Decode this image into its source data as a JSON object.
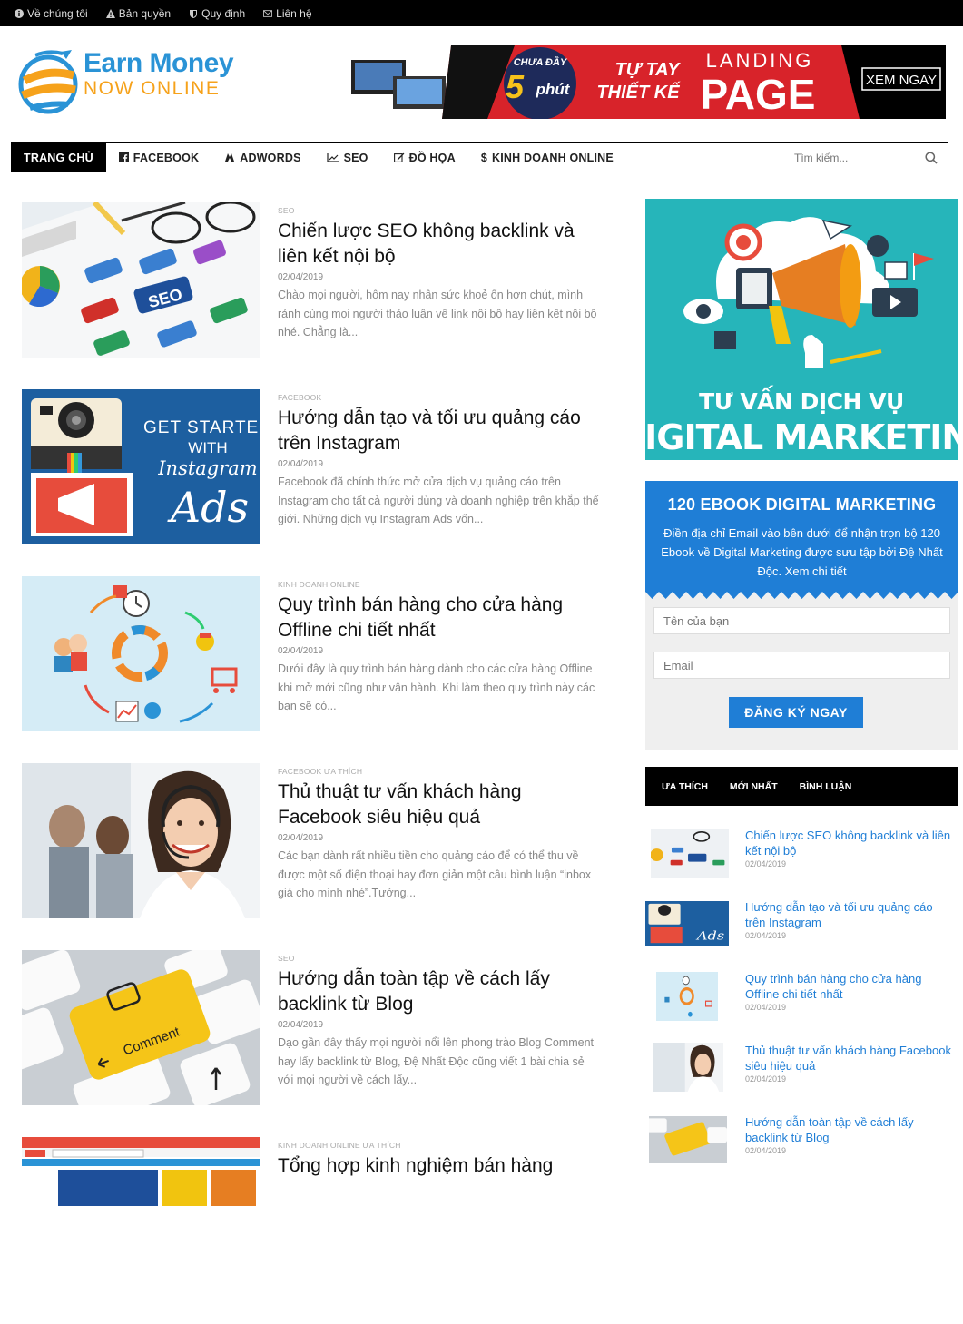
{
  "topbar": {
    "links": [
      {
        "label": "Về chúng tôi",
        "icon": "info-icon"
      },
      {
        "label": "Bản quyền",
        "icon": "warning-icon"
      },
      {
        "label": "Quy định",
        "icon": "shield-icon"
      },
      {
        "label": "Liên hệ",
        "icon": "mail-icon"
      }
    ]
  },
  "logo": {
    "word1": "Earn ",
    "word2": "Money",
    "line2": "NOW ONLINE"
  },
  "banner": {
    "line1": "CHƯA ĐẦY",
    "big": "5",
    "unit": "phút",
    "mid1": "TỰ TAY",
    "mid2": "THIẾT KẾ",
    "top": "LANDING",
    "main": "PAGE",
    "cta": "XEM NGAY"
  },
  "nav": {
    "items": [
      {
        "label": "TRANG CHỦ"
      },
      {
        "label": "FACEBOOK"
      },
      {
        "label": "ADWORDS"
      },
      {
        "label": "SEO"
      },
      {
        "label": "ĐỒ HỌA"
      },
      {
        "label": "KINH DOANH ONLINE"
      }
    ],
    "search_placeholder": "Tìm kiếm..."
  },
  "posts": [
    {
      "category": "SEO",
      "title": "Chiến lược SEO không backlink và liên kết nội bộ",
      "date": "02/04/2019",
      "excerpt": "Chào mọi người, hôm nay nhân sức khoẻ ổn hơn chút, mình rảnh cùng mọi người thảo luận về link nội bộ hay liên kết nội bộ nhé. Chẳng là..."
    },
    {
      "category": "FACEBOOK",
      "title": "Hướng dẫn tạo và tối ưu quảng cáo trên Instagram",
      "date": "02/04/2019",
      "excerpt": "Facebook đã chính thức mở cửa dịch vụ quảng cáo trên Instagram cho tất cả người dùng và doanh nghiệp trên khắp thế giới. Những dịch vụ Instagram Ads vốn..."
    },
    {
      "category": "KINH DOANH ONLINE",
      "title": "Quy trình bán hàng cho cửa hàng Offline chi tiết nhất",
      "date": "02/04/2019",
      "excerpt": "Dưới đây là quy trình bán hàng dành cho các cửa hàng Offline khi mở mới cũng như vận hành. Khi làm theo quy trình này các bạn sẽ có..."
    },
    {
      "category": "FACEBOOK ƯA THÍCH",
      "title": "Thủ thuật tư vấn khách hàng Facebook siêu hiệu quả",
      "date": "02/04/2019",
      "excerpt": "Các bạn dành rất nhiều tiền cho quảng cáo để có thể thu về được một số điện thoại hay đơn giản một câu bình luận “inbox giá cho mình nhé”.Tưởng..."
    },
    {
      "category": "SEO",
      "title": "Hướng dẫn toàn tập về cách lấy backlink từ Blog",
      "date": "02/04/2019",
      "excerpt": "Dạo gần đây thấy mọi người nổi lên phong trào Blog Comment hay lấy backlink từ Blog, Đệ Nhất Độc cũng viết 1 bài chia sẻ với mọi người về cách lấy..."
    },
    {
      "category": "KINH DOANH ONLINE ƯA THÍCH",
      "title": "Tổng hợp kinh nghiệm bán hàng",
      "date": "",
      "excerpt": ""
    }
  ],
  "sidebar": {
    "ad": {
      "line1": "TƯ VẤN DỊCH VỤ",
      "line2": "DIGITAL MARKETING"
    },
    "ebook": {
      "title": "120 EBOOK DIGITAL MARKETING",
      "desc": "Điền địa chỉ Email vào bên dưới để nhận trọn bộ 120 Ebook về Digital Marketing được sưu tập bởi Đệ Nhất Độc. Xem chi tiết",
      "name_placeholder": "Tên của bạn",
      "email_placeholder": "Email",
      "button": "ĐĂNG KÝ NGAY"
    },
    "tabs": [
      "ƯA THÍCH",
      "MỚI NHẤT",
      "BÌNH LUẬN"
    ],
    "mini_posts": [
      {
        "title": "Chiến lược SEO không backlink và liên kết nội bộ",
        "date": "02/04/2019"
      },
      {
        "title": "Hướng dẫn tạo và tối ưu quảng cáo trên Instagram",
        "date": "02/04/2019"
      },
      {
        "title": "Quy trình bán hàng cho cửa hàng Offline chi tiết nhất",
        "date": "02/04/2019"
      },
      {
        "title": "Thủ thuật tư vấn khách hàng Facebook siêu hiệu quả",
        "date": "02/04/2019"
      },
      {
        "title": "Hướng dẫn toàn tập về cách lấy backlink từ Blog",
        "date": "02/04/2019"
      }
    ]
  },
  "colors": {
    "accent": "#1f7ed6",
    "black": "#000000",
    "teal": "#26b5ba",
    "banner_red": "#d8232a",
    "logo_orange": "#f6a21b",
    "logo_blue": "#2a93d6"
  }
}
